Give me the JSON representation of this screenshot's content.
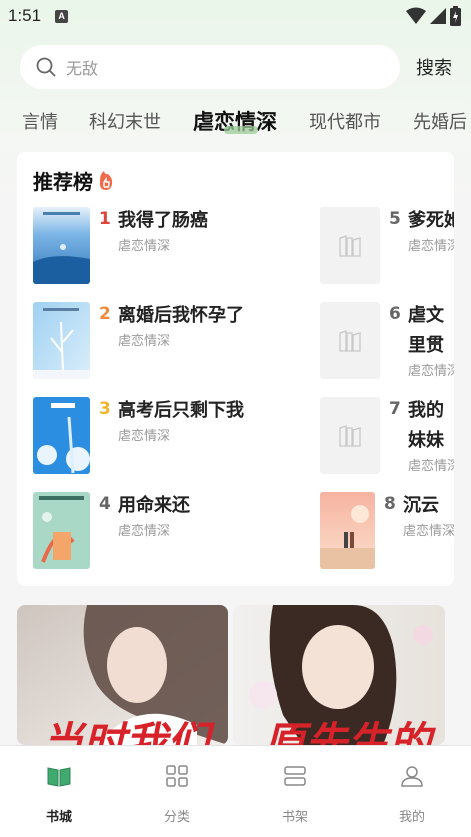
{
  "status_bar": {
    "time": "1:51",
    "notification_letter": "A"
  },
  "search": {
    "placeholder": "无敌",
    "button_label": "搜索"
  },
  "tabs": [
    {
      "label": "言情"
    },
    {
      "label": "科幻末世"
    },
    {
      "label": "虐恋情深",
      "active": true
    },
    {
      "label": "现代都市"
    },
    {
      "label": "先婚后"
    }
  ],
  "rank": {
    "title": "推荐榜",
    "items": [
      {
        "num": "1",
        "title": "我得了肠癌",
        "genre": "虐恋情深"
      },
      {
        "num": "2",
        "title": "离婚后我怀孕了",
        "genre": "虐恋情深"
      },
      {
        "num": "3",
        "title": "高考后只剩下我",
        "genre": "虐恋情深"
      },
      {
        "num": "4",
        "title": "用命来还",
        "genre": "虐恋情深"
      },
      {
        "num": "5",
        "title": "爹死她",
        "genre": "虐恋情深"
      },
      {
        "num": "6",
        "title": "虐文里贯",
        "genre": "虐恋情深"
      },
      {
        "num": "7",
        "title": "我的妹妹",
        "genre": "虐恋情深"
      },
      {
        "num": "8",
        "title": "沉云",
        "genre": "虐恋情深"
      }
    ]
  },
  "banners": [
    {
      "text": "当时我们"
    },
    {
      "text": "原先生的"
    }
  ],
  "bottom_nav": [
    {
      "label": "书城",
      "icon": "book-open-icon",
      "active": true
    },
    {
      "label": "分类",
      "icon": "grid-icon"
    },
    {
      "label": "书架",
      "icon": "bookshelf-icon"
    },
    {
      "label": "我的",
      "icon": "user-icon"
    }
  ],
  "colors": {
    "accent_green": "#3fa96f",
    "rank1": "#e0443a",
    "rank2": "#f08a3c",
    "rank3": "#f2b531",
    "rank_other": "#666666"
  }
}
